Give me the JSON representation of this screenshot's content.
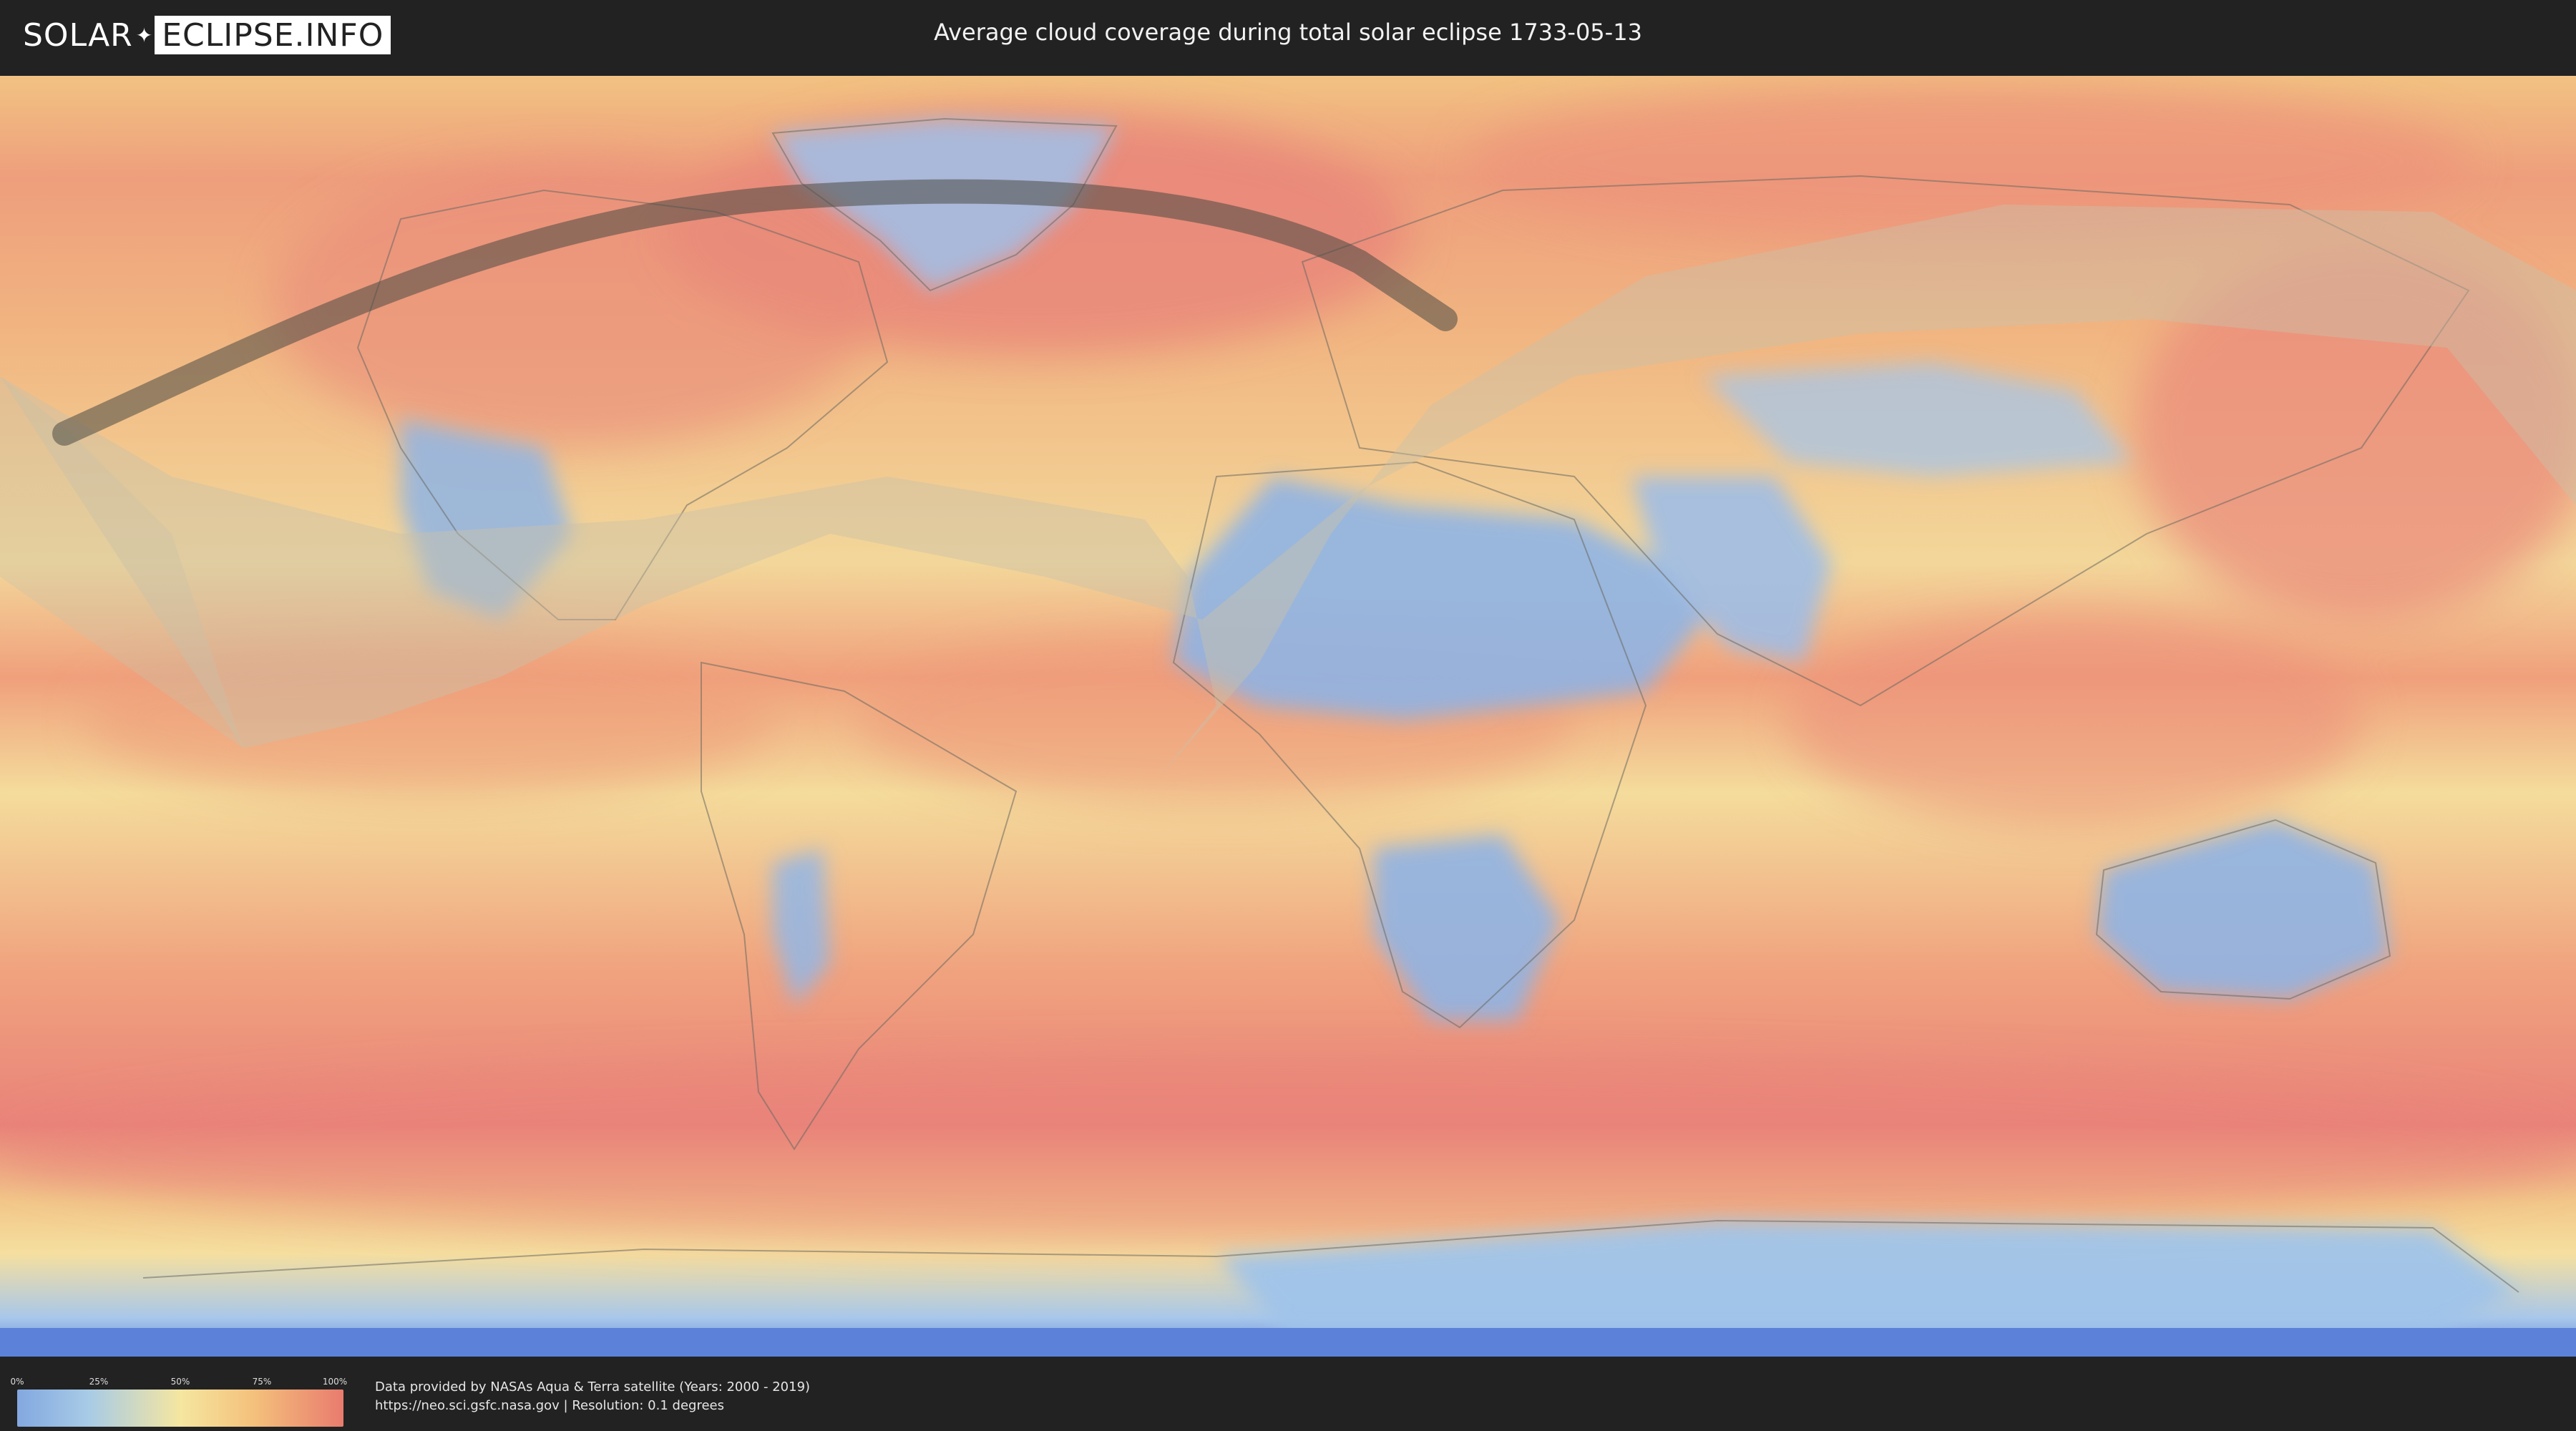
{
  "header": {
    "logo_left": "SOLAR",
    "logo_right": "ECLIPSE.INFO",
    "title": "Average cloud coverage during total solar eclipse 1733-05-13"
  },
  "legend": {
    "ticks": [
      {
        "label": "0%",
        "fraction": 0.0
      },
      {
        "label": "25%",
        "fraction": 0.25
      },
      {
        "label": "50%",
        "fraction": 0.5
      },
      {
        "label": "75%",
        "fraction": 0.75
      },
      {
        "label": "100%",
        "fraction": 1.0
      }
    ],
    "colors": [
      "#82a8e0",
      "#a8cbe6",
      "#f5e6a0",
      "#f4c27c",
      "#e97b6e"
    ]
  },
  "footer": {
    "credit_line1": "Data provided by NASAs Aqua & Terra satellite (Years: 2000 - 2019)",
    "credit_line2": "https://neo.sci.gsfc.nasa.gov | Resolution: 0.1 degrees"
  },
  "map": {
    "colors": {
      "ocean_cloudy": "#e9867a",
      "ocean_mid": "#f1bd80",
      "clear": "#8fb4e4",
      "moderate": "#f3dc9a",
      "antarctic_ice": "#9fc3ea",
      "deep_blue": "#5b82d8",
      "eclipse_path": "#4a4a44",
      "penumbra": "#c9c2a8"
    }
  }
}
